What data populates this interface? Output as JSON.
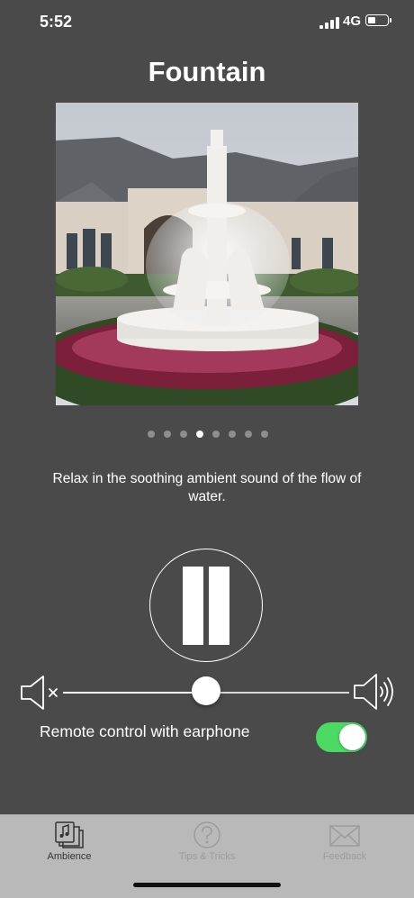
{
  "status_bar": {
    "time": "5:52",
    "network": "4G",
    "battery_level": 0.4
  },
  "screen": {
    "title": "Fountain",
    "description": "Relax in the soothing ambient sound of the flow of water.",
    "image_icon": "fountain-photo",
    "page_indicator": {
      "count": 8,
      "current_index": 3
    }
  },
  "player": {
    "state": "playing",
    "control_icon": "pause-icon",
    "volume_level": 0.5
  },
  "settings": {
    "remote_control_label": "Remote control with earphone",
    "remote_control_enabled": true
  },
  "tab_bar": {
    "tabs": [
      {
        "label": "Ambience",
        "icon": "ambience-icon",
        "active": true
      },
      {
        "label": "Tips & Tricks",
        "icon": "question-icon",
        "active": false
      },
      {
        "label": "Feedback",
        "icon": "envelope-icon",
        "active": false
      }
    ]
  },
  "colors": {
    "background": "#4a4a4a",
    "toggle_on": "#4cd964",
    "tab_bar": "#b9b9b9"
  }
}
